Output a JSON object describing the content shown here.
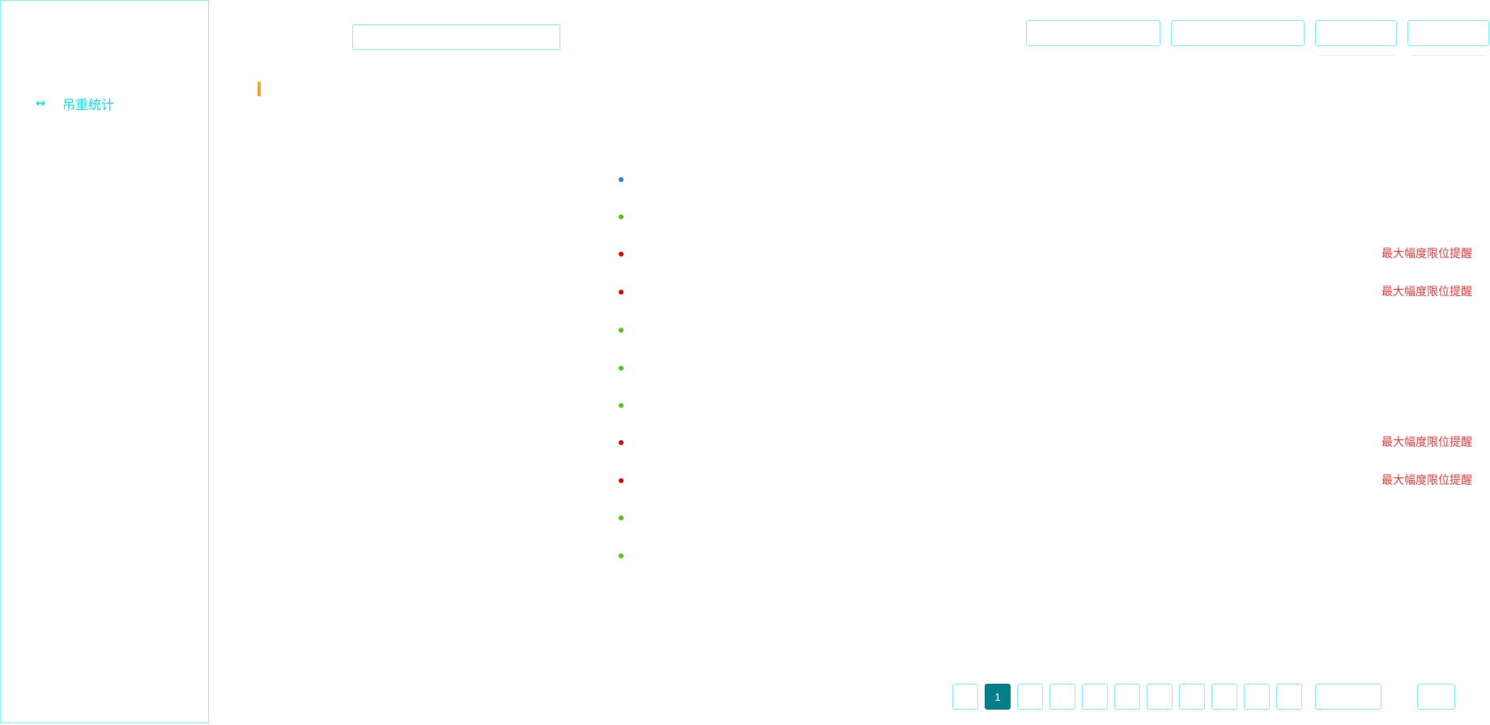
{
  "sidebar": {
    "items": [
      {
        "label": "吊重统计",
        "icon": "resize-horizontal-icon",
        "glyph": "↔"
      }
    ]
  },
  "search": {
    "value": "",
    "placeholder": ""
  },
  "toolbar": {
    "button_1_label": "",
    "button_2_label": "",
    "button_3_label": "",
    "button_4_label": ""
  },
  "section": {
    "title": ""
  },
  "records": [
    {
      "status": "info",
      "status_color": "#1e88e5",
      "text": "",
      "alarm": ""
    },
    {
      "status": "normal",
      "status_color": "#52c41a",
      "text": "",
      "alarm": ""
    },
    {
      "status": "alarm",
      "status_color": "#e60000",
      "text": "",
      "alarm": "最大幅度限位提醒"
    },
    {
      "status": "alarm",
      "status_color": "#e60000",
      "text": "",
      "alarm": "最大幅度限位提醒"
    },
    {
      "status": "normal",
      "status_color": "#52c41a",
      "text": "",
      "alarm": ""
    },
    {
      "status": "normal",
      "status_color": "#52c41a",
      "text": "",
      "alarm": ""
    },
    {
      "status": "normal",
      "status_color": "#52c41a",
      "text": "",
      "alarm": ""
    },
    {
      "status": "alarm",
      "status_color": "#e60000",
      "text": "",
      "alarm": "最大幅度限位提醒"
    },
    {
      "status": "alarm",
      "status_color": "#e60000",
      "text": "",
      "alarm": "最大幅度限位提醒"
    },
    {
      "status": "normal",
      "status_color": "#52c41a",
      "text": "",
      "alarm": ""
    },
    {
      "status": "normal",
      "status_color": "#52c41a",
      "text": "",
      "alarm": ""
    }
  ],
  "pagination": {
    "current_page": "1",
    "prev_label": "",
    "pages": [
      "1",
      "",
      "",
      "",
      "",
      "",
      "",
      "",
      "",
      ""
    ],
    "jump_value": "",
    "page_size_label": ""
  },
  "colors": {
    "accent": "#00e5e5",
    "border": "#7ff3f3",
    "active_page": "#047e88",
    "marker": "#f5a623",
    "alarm_text": "#f03c3c"
  }
}
